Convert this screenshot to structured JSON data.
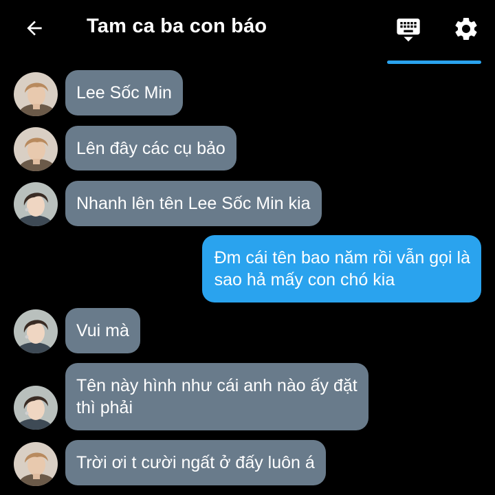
{
  "header": {
    "title": "Tam ca ba con báo",
    "back_icon": "arrow-left-icon",
    "keyboard_icon": "keyboard-icon",
    "settings_icon": "gear-icon",
    "accent_color": "#2aa3ee"
  },
  "colors": {
    "background": "#000000",
    "incoming_bubble": "#697b8b",
    "outgoing_bubble": "#2aa3ee",
    "text": "#ffffff"
  },
  "messages": [
    {
      "sender": "other",
      "avatar": "avatar-a",
      "lines": [
        "Lee Sốc Min"
      ]
    },
    {
      "sender": "other",
      "avatar": "avatar-a",
      "lines": [
        "Lên đây các cụ bảo"
      ]
    },
    {
      "sender": "other",
      "avatar": "avatar-b",
      "lines": [
        "Nhanh lên tên Lee Sốc Min kia"
      ]
    },
    {
      "sender": "me",
      "lines": [
        "Đm cái tên bao năm rồi vẫn gọi là",
        "sao hả mấy con chó kia"
      ]
    },
    {
      "sender": "other",
      "avatar": "avatar-b",
      "lines": [
        "Vui mà"
      ]
    },
    {
      "sender": "other",
      "avatar": "avatar-b",
      "lines": [
        "Tên này hình như cái anh nào ấy đặt",
        "thì phải"
      ]
    },
    {
      "sender": "other",
      "avatar": "avatar-a",
      "lines": [
        "Trời ơi t cười ngất ở đấy luôn á"
      ]
    }
  ]
}
